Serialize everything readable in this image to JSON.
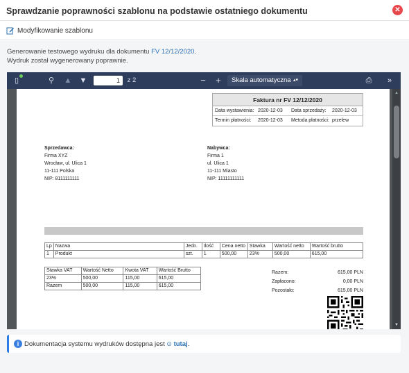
{
  "header": {
    "title": "Sprawdzanie poprawności szablonu na podstawie ostatniego dokumentu",
    "close_icon": "close-icon"
  },
  "modify": {
    "label": "Modyfikowanie szablonu",
    "icon": "edit-icon"
  },
  "info": {
    "line1_prefix": "Generowanie testowego wydruku dla dokumentu",
    "doc_link": "FV 12/12/2020",
    "line1_suffix": ".",
    "line2": "Wydruk został wygenerowany poprawnie."
  },
  "viewer": {
    "page_value": "1",
    "page_total": "z 2",
    "zoom_label": "Skala automatyczna",
    "zoom_out": "−",
    "zoom_in": "+"
  },
  "invoice": {
    "title": "Faktura nr FV 12/12/2020",
    "data_wystawienia_label": "Data wystawienia:",
    "data_wystawienia": "2020-12-03",
    "data_sprzedazy_label": "Data sprzedaży:",
    "data_sprzedazy": "2020-12-03",
    "termin_label": "Termin płatności:",
    "termin": "2020-12-03",
    "metoda_label": "Metoda płatności:",
    "metoda": "przelew",
    "seller": {
      "heading": "Sprzedawca:",
      "name": "Firma XYZ",
      "street": "Wrocław, ul. Ulica 1",
      "city": "11-111 Polska",
      "nip": "NIP: 8111111111"
    },
    "buyer": {
      "heading": "Nabywca:",
      "name": "Firma 1",
      "street": "ul. Ulica 1",
      "city": "11-111 Miasto",
      "nip": "NIP: 11111111111"
    },
    "items_headers": [
      "Lp",
      "Nazwa",
      "Jedn.",
      "Ilość",
      "Cena netto",
      "Stawka",
      "Wartość netto",
      "Wartość brutto"
    ],
    "items_rows": [
      [
        "1",
        "Produkt",
        "szt.",
        "1",
        "500,00",
        "23%",
        "500,00",
        "615,00"
      ]
    ],
    "vat_headers": [
      "Stawka VAT",
      "Wartość Netto",
      "Kwota VAT",
      "Wartość Brutto"
    ],
    "vat_rows": [
      [
        "23%",
        "500,00",
        "115,00",
        "615,00"
      ],
      [
        "Razem",
        "500,00",
        "115,00",
        "615,00"
      ]
    ],
    "summary": [
      {
        "label": "Razem:",
        "value": "615,00 PLN"
      },
      {
        "label": "Zapłacono:",
        "value": "0,00 PLN"
      },
      {
        "label": "Pozostało:",
        "value": "615,00 PLN"
      }
    ]
  },
  "notice": {
    "text": "Dokumentacja systemu wydruków dostępna jest",
    "link": "tutaj",
    "suffix": "."
  }
}
